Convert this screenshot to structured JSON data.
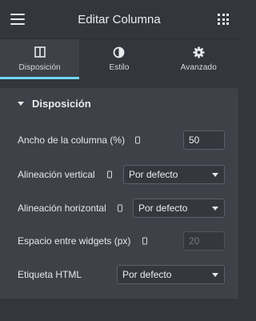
{
  "header": {
    "title": "Editar Columna",
    "menu_icon": "hamburger-icon",
    "apps_icon": "grid-icon"
  },
  "tabs": [
    {
      "label": "Disposición",
      "icon": "columns-icon",
      "active": true
    },
    {
      "label": "Estilo",
      "icon": "half-circle-icon",
      "active": false
    },
    {
      "label": "Avanzado",
      "icon": "gear-icon",
      "active": false
    }
  ],
  "section": {
    "title": "Disposición",
    "expanded": true
  },
  "controls": {
    "column_width": {
      "label": "Ancho de la columna (%)",
      "value": "50"
    },
    "vertical_align": {
      "label": "Alineación vertical",
      "value": "Por defecto"
    },
    "horizontal_align": {
      "label": "Alineación horizontal",
      "value": "Por defecto"
    },
    "widget_spacing": {
      "label": "Espacio entre widgets (px)",
      "placeholder": "20"
    },
    "html_tag": {
      "label": "Etiqueta HTML",
      "value": "Por defecto"
    }
  },
  "colors": {
    "accent": "#71d7f7",
    "panel": "#3e4148",
    "background": "#33363c"
  }
}
